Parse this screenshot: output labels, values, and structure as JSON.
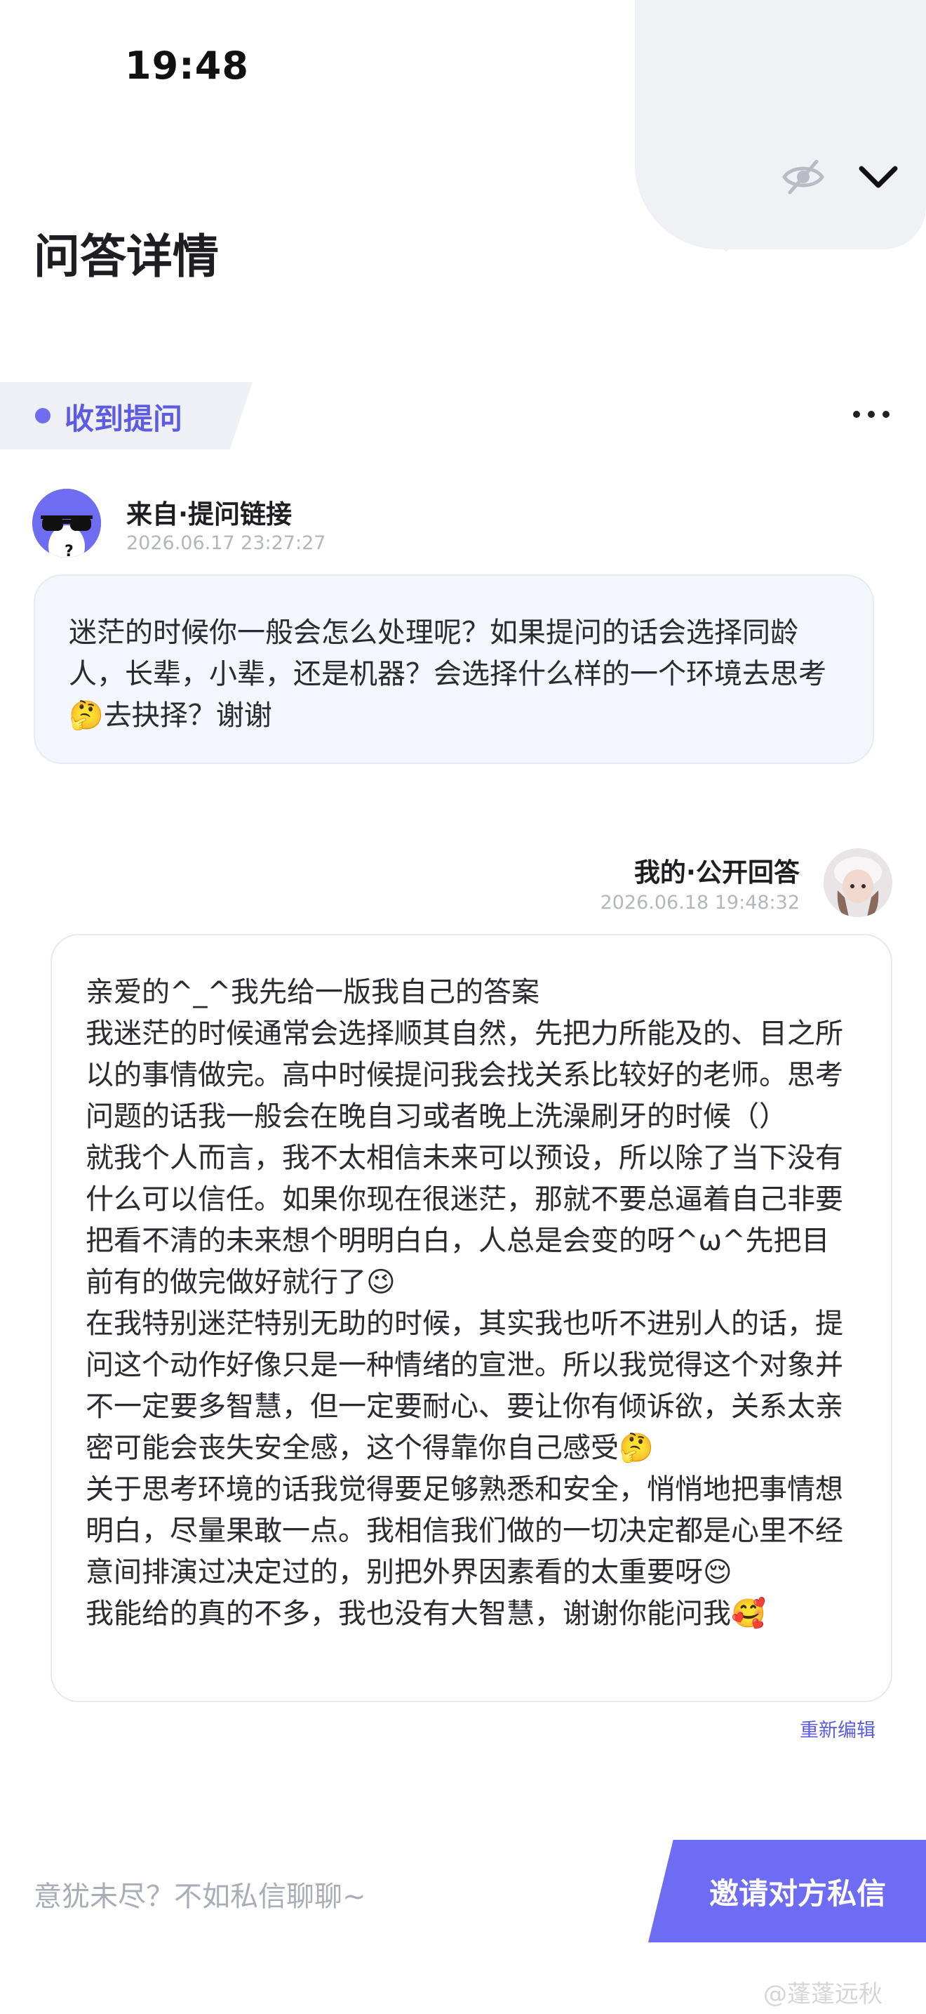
{
  "status_bar": {
    "time": "19:48"
  },
  "header": {
    "title": "问答详情"
  },
  "received_tag": {
    "label": "收到提问"
  },
  "question": {
    "from_label": "来自·提问链接",
    "timestamp": "2026.06.17 23:27:27",
    "text": "迷茫的时候你一般会怎么处理呢？如果提问的话会选择同龄人，长辈，小辈，还是机器？会选择什么样的一个环境去思考🤔去抉择？谢谢"
  },
  "answer": {
    "from_label": "我的·公开回答",
    "timestamp": "2026.06.18 19:48:32",
    "text": "亲爱的^_^我先给一版我自己的答案\n我迷茫的时候通常会选择顺其自然，先把力所能及的、目之所以的事情做完。高中时候提问我会找关系比较好的老师。思考问题的话我一般会在晚自习或者晚上洗澡刷牙的时候（）\n就我个人而言，我不太相信未来可以预设，所以除了当下没有什么可以信任。如果你现在很迷茫，那就不要总逼着自己非要把看不清的未来想个明明白白，人总是会变的呀^ω^先把目前有的做完做好就行了😉\n在我特别迷茫特别无助的时候，其实我也听不进别人的话，提问这个动作好像只是一种情绪的宣泄。所以我觉得这个对象并不一定要多智慧，但一定要耐心、要让你有倾诉欲，关系太亲密可能会丧失安全感，这个得靠你自己感受🤔\n关于思考环境的话我觉得要足够熟悉和安全，悄悄地把事情想明白，尽量果敢一点。我相信我们做的一切决定都是心里不经意间排演过决定过的，别把外界因素看的太重要呀😌\n我能给的真的不多，我也没有大智慧，谢谢你能问我🥰",
    "reedit_label": "重新编辑"
  },
  "bottom_bar": {
    "prompt": "意犹未尽？不如私信聊聊~",
    "invite_button": "邀请对方私信"
  },
  "watermark": "@蓬蓬远秋",
  "colors": {
    "accent": "#6d6cf2",
    "question_bg": "#f3f6fd",
    "tag_bg": "#eef0f5"
  }
}
